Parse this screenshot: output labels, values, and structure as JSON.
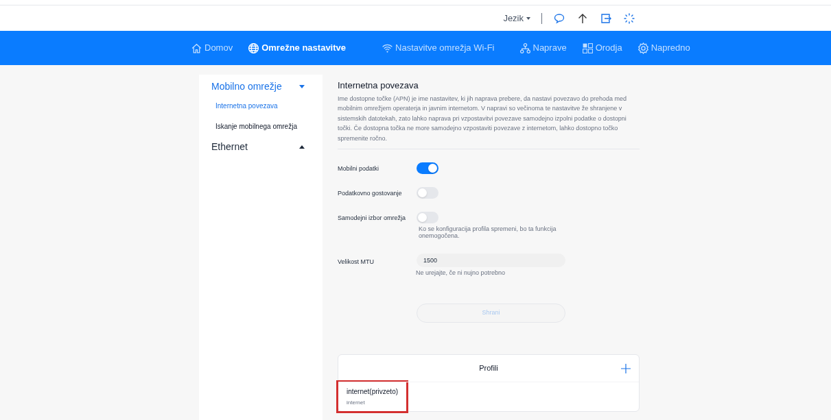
{
  "top_bar": {
    "language": "Jezik"
  },
  "nav": [
    {
      "label": "Domov",
      "selected": false
    },
    {
      "label": "Omrežne nastavitve",
      "selected": true
    },
    {
      "label": "Nastavitve omrežja Wi-Fi",
      "selected": false
    },
    {
      "label": "Naprave",
      "selected": false
    },
    {
      "label": "Orodja",
      "selected": false
    },
    {
      "label": "Napredno",
      "selected": false
    }
  ],
  "sidebar": {
    "items": [
      {
        "label": "Mobilno omrežje",
        "expanded": true,
        "children": [
          {
            "label": "Internetna povezava",
            "selected": true
          },
          {
            "label": "Iskanje mobilnega omrežja",
            "selected": false
          }
        ]
      },
      {
        "label": "Ethernet",
        "expanded": false
      }
    ]
  },
  "content": {
    "title": "Internetna povezava",
    "description": "Ime dostopne točke (APN) je ime nastavitev, ki jih naprava prebere, da nastavi povezavo do prehoda med mobilnim omrežjem operaterja in javnim internetom. V napravi so večinoma te nastavitve že shranjene v sistemskih datotekah, zato lahko naprava pri vzpostavitvi povezave samodejno izpolni podatke o dostopni točki. Če dostopna točka ne more samodejno vzpostaviti povezave z internetom, lahko dostopno točko spremenite ročno.",
    "settings": [
      {
        "kind": "toggle",
        "label": "Mobilni podatki",
        "on": true
      },
      {
        "kind": "toggle",
        "label": "Podatkovno gostovanje",
        "on": false
      },
      {
        "kind": "toggle",
        "label": "Samodejni izbor omrežja",
        "on": false,
        "note": "Ko se konfiguracija profila spremeni, bo ta funkcija onemogočena."
      },
      {
        "kind": "input",
        "label": "Velikost MTU",
        "value": "1500",
        "note": "Ne urejajte, če ni nujno potrebno"
      }
    ],
    "save_button": {
      "label": "Shrani",
      "disabled": true
    },
    "profiles": {
      "title": "Profili",
      "items": [
        {
          "name": "internet(privzeto)",
          "apn": "internet",
          "highlighted": true
        }
      ]
    }
  }
}
